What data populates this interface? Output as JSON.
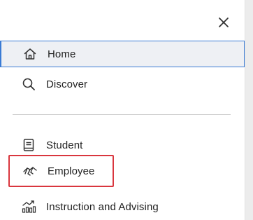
{
  "header": {
    "close_icon": "close-icon"
  },
  "nav": {
    "primary": [
      {
        "label": "Home",
        "icon": "home-icon"
      },
      {
        "label": "Discover",
        "icon": "search-icon"
      }
    ],
    "secondary": [
      {
        "label": "Student",
        "icon": "book-icon"
      },
      {
        "label": "Employee",
        "icon": "handshake-icon"
      },
      {
        "label": "Instruction and Advising",
        "icon": "growth-chart-icon"
      }
    ]
  },
  "colors": {
    "active_border": "#3a7bd5",
    "active_background": "#eef0f4",
    "highlight_outline": "#d9363e"
  }
}
